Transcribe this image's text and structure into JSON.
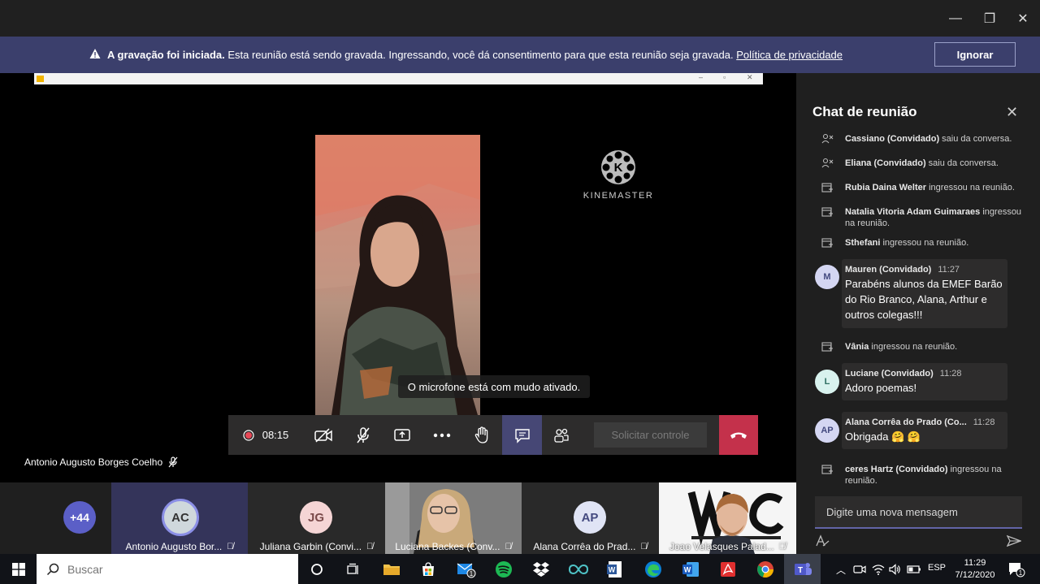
{
  "window": {
    "minimize_glyph": "—",
    "maximize_glyph": "❐",
    "close_glyph": "✕"
  },
  "banner": {
    "bold_text": "A gravação foi iniciada.",
    "text": " Esta reunião está sendo gravada. Ingressando, você dá consentimento para que esta reunião seja gravada. ",
    "link": "Política de privacidade",
    "ignore_label": "Ignorar"
  },
  "stage": {
    "watermark": "KINEMASTER",
    "watermark_letter": "K",
    "mute_toast": "O microfone está com mudo ativado.",
    "presenter_name": "Antonio Augusto Borges Coelho"
  },
  "controls": {
    "recording_time": "08:15",
    "request_control_label": "Solicitar controle"
  },
  "participants": {
    "overflow_count": "+44",
    "tiles": [
      {
        "initials": "AC",
        "name": "Antonio Augusto Bor..."
      },
      {
        "initials": "JG",
        "name": "Juliana Garbin (Convi..."
      },
      {
        "initials": "",
        "name": "Luciana Backes (Conv..."
      },
      {
        "initials": "AP",
        "name": "Alana Corrêa do Prad..."
      },
      {
        "initials": "",
        "name": "Joao Velasques Palad..."
      }
    ]
  },
  "chat": {
    "title": "Chat de reunião",
    "events": [
      {
        "who": "Cassiano (Convidado)",
        "what": " saiu da conversa."
      },
      {
        "who": "Eliana (Convidado)",
        "what": " saiu da conversa."
      },
      {
        "who": "Rubia Daina Welter",
        "what": " ingressou na reunião."
      },
      {
        "who": "Natalia Vitoria Adam Guimaraes",
        "what": " ingressou na reunião."
      },
      {
        "who": "Sthefani",
        "what": " ingressou na reunião."
      },
      {
        "who": "Vânia",
        "what": " ingressou na reunião."
      },
      {
        "who": "ceres Hartz (Convidado)",
        "what": " ingressou na reunião."
      }
    ],
    "messages": [
      {
        "initials": "M",
        "author": "Mauren (Convidado)",
        "time": "11:27",
        "text": "Parabéns alunos da EMEF Barão do Rio Branco, Alana, Arthur e outros colegas!!!"
      },
      {
        "initials": "L",
        "author": "Luciane (Convidado)",
        "time": "11:28",
        "text": "Adoro poemas!"
      },
      {
        "initials": "AP",
        "author": "Alana Corrêa do Prado (Co...",
        "time": "11:28",
        "text": "Obrigada 🤗 🤗"
      }
    ],
    "input_placeholder": "Digite uma nova mensagem"
  },
  "taskbar": {
    "search_placeholder": "Buscar",
    "mail_badge": "1",
    "language": "ESP",
    "time": "11:29",
    "date": "7/12/2020",
    "notification_badge": "1"
  },
  "colors": {
    "teams_purple": "#6264a7",
    "banner_bg": "#3b3f6c",
    "hangup_red": "#c4314b",
    "record_red": "#e74856"
  }
}
